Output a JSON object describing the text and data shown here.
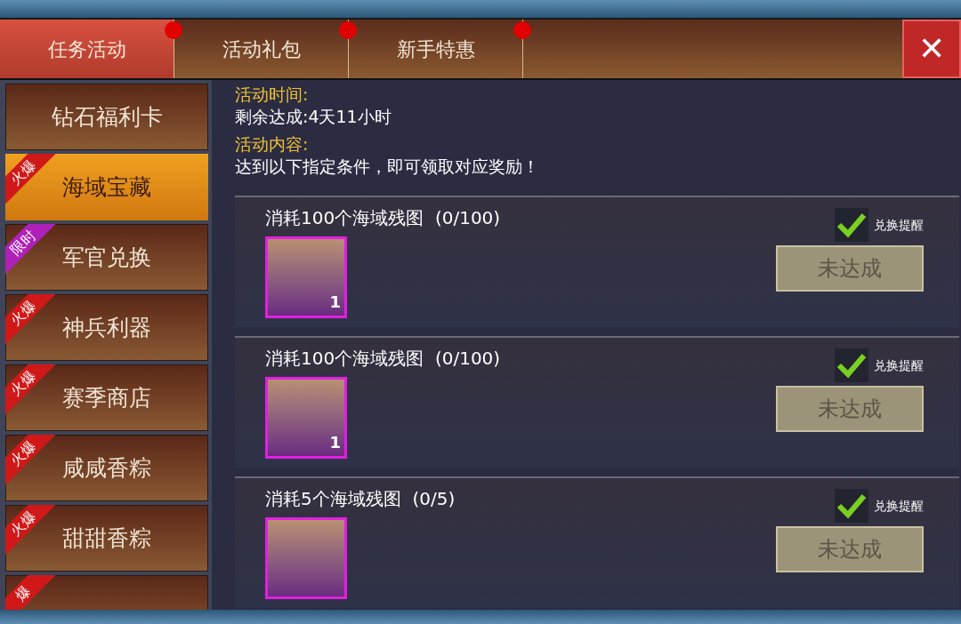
{
  "tabs": [
    {
      "label": "任务活动",
      "selected": true,
      "notification": true
    },
    {
      "label": "活动礼包",
      "selected": false,
      "notification": true
    },
    {
      "label": "新手特惠",
      "selected": false,
      "notification": true
    }
  ],
  "close_button": {
    "label": "✕"
  },
  "sidebar": {
    "items": [
      {
        "label": "钻石福利卡",
        "selected": false
      },
      {
        "label": "海域宝藏",
        "selected": true,
        "tag": "火爆",
        "color": "#d01818"
      },
      {
        "label": "军官兑换",
        "selected": false,
        "tag": "限时",
        "color": "#b020b8"
      },
      {
        "label": "神兵利器",
        "selected": false,
        "tag": "火爆",
        "color": "#d01818"
      },
      {
        "label": "赛季商店",
        "selected": false,
        "tag": "火爆",
        "color": "#d01818"
      },
      {
        "label": "咸咸香粽",
        "selected": false,
        "tag": "火爆",
        "color": "#d01818"
      },
      {
        "label": "甜甜香粽",
        "selected": false,
        "tag": "火爆",
        "color": "#d01818"
      },
      {
        "selected": false,
        "tag": "爆",
        "color": "#d01818"
      }
    ]
  },
  "info": [
    {
      "heading": "活动时间:",
      "text": "剩余达成:4天11小时"
    },
    {
      "heading": "活动内容:",
      "text": "达到以下指定条件，即可领取对应奖励！"
    }
  ],
  "tasks": [
    {
      "title": "消耗100个海域残图  (0/100)",
      "reward_count": "1",
      "reminder": {
        "label": "兑换提醒",
        "checked": true
      },
      "button": {
        "label": "未达成",
        "disabled": true
      }
    },
    {
      "title": "消耗100个海域残图  (0/100)",
      "reward_count": "1",
      "reminder": {
        "label": "兑换提醒",
        "checked": true
      },
      "button": {
        "label": "未达成",
        "disabled": true
      }
    },
    {
      "title": "消耗5个海域残图  (0/5)",
      "reminder": {
        "label": "兑换提醒",
        "checked": true
      },
      "button": {
        "label": "未达成",
        "disabled": true
      }
    }
  ]
}
